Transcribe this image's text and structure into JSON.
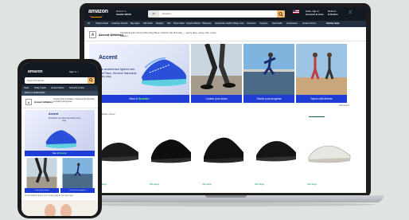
{
  "header": {
    "logo": "amazon",
    "deliver_line1": "Deliver to",
    "deliver_line2": "Seattle 98119",
    "search_scope": "All",
    "search_query": "amazon",
    "account_line1": "Hello, sign in",
    "account_line2": "Account & Lists",
    "orders_line1": "Returns",
    "orders_line2": "& Orders",
    "cart_label": "Cart"
  },
  "nav": {
    "items": [
      "All",
      "Today's Deals",
      "Customer Service",
      "Buy Again",
      "Gift Cards",
      "Registry",
      "Sell",
      "Prime Video",
      "Amazon Basics",
      "Pharmacy",
      "Household, Health & Baby Care",
      "Groceries",
      "Coupons",
      "Handmade",
      "Livestreams",
      "Amazon Home"
    ],
    "promo": "Holiday deals"
  },
  "brand": {
    "name": "Accent Athletics",
    "tagline": "Introducing the Accent Running Shoe: built for the first step — every lace, every mile, every season."
  },
  "hero": {
    "product_label": "Accent",
    "subline": "Our smartest and lightest ever. First Place, the shoe that tracks every step.",
    "caption_prefix": "New & ",
    "caption_highlight": "Smarter"
  },
  "tiles": [
    {
      "caption": "Counts your steps"
    },
    {
      "caption": "Tracks your progress"
    },
    {
      "caption": "Syncs with friends"
    }
  ],
  "products": {
    "section_title": "Shoes",
    "section_note": "Accent Athletic shoes",
    "sponsored": "Sponsored",
    "badge": "Overall Pick",
    "items": [
      {
        "label": "150 ratings"
      },
      {
        "label": "150 ratings"
      },
      {
        "label": "150 ratings"
      },
      {
        "label": "150 ratings"
      },
      {
        "label": "150 ratings"
      }
    ]
  },
  "phone": {
    "logo": "amazon",
    "status": "Sign in >",
    "search_placeholder": "Search Amazon",
    "nav_items": [
      "Deals",
      "Today's Deals",
      "Amazon Basics",
      "Subscribe & Save"
    ],
    "deliver": "Deliver to Seattle 98119",
    "brand_name": "Accent Athletics",
    "brand_tagline": "Accent's New & Notable. Introduces the first step counting running shoe.",
    "hero_label": "Accent",
    "hero_sub": "First Place, the shoe that tracks every step.",
    "hero_caption_prefix": "New & ",
    "hero_caption_highlight": "Smarter",
    "tiles": [
      {
        "caption": "Counts your steps"
      },
      {
        "caption": "Tracks your progress"
      }
    ],
    "footer_text": "Accent Athletic shoes, your running partner for every step."
  },
  "colors": {
    "amazon_dark": "#131921",
    "amazon_nav": "#232f3e",
    "amazon_orange": "#febd69",
    "brand_blue": "#1d3dd6"
  }
}
